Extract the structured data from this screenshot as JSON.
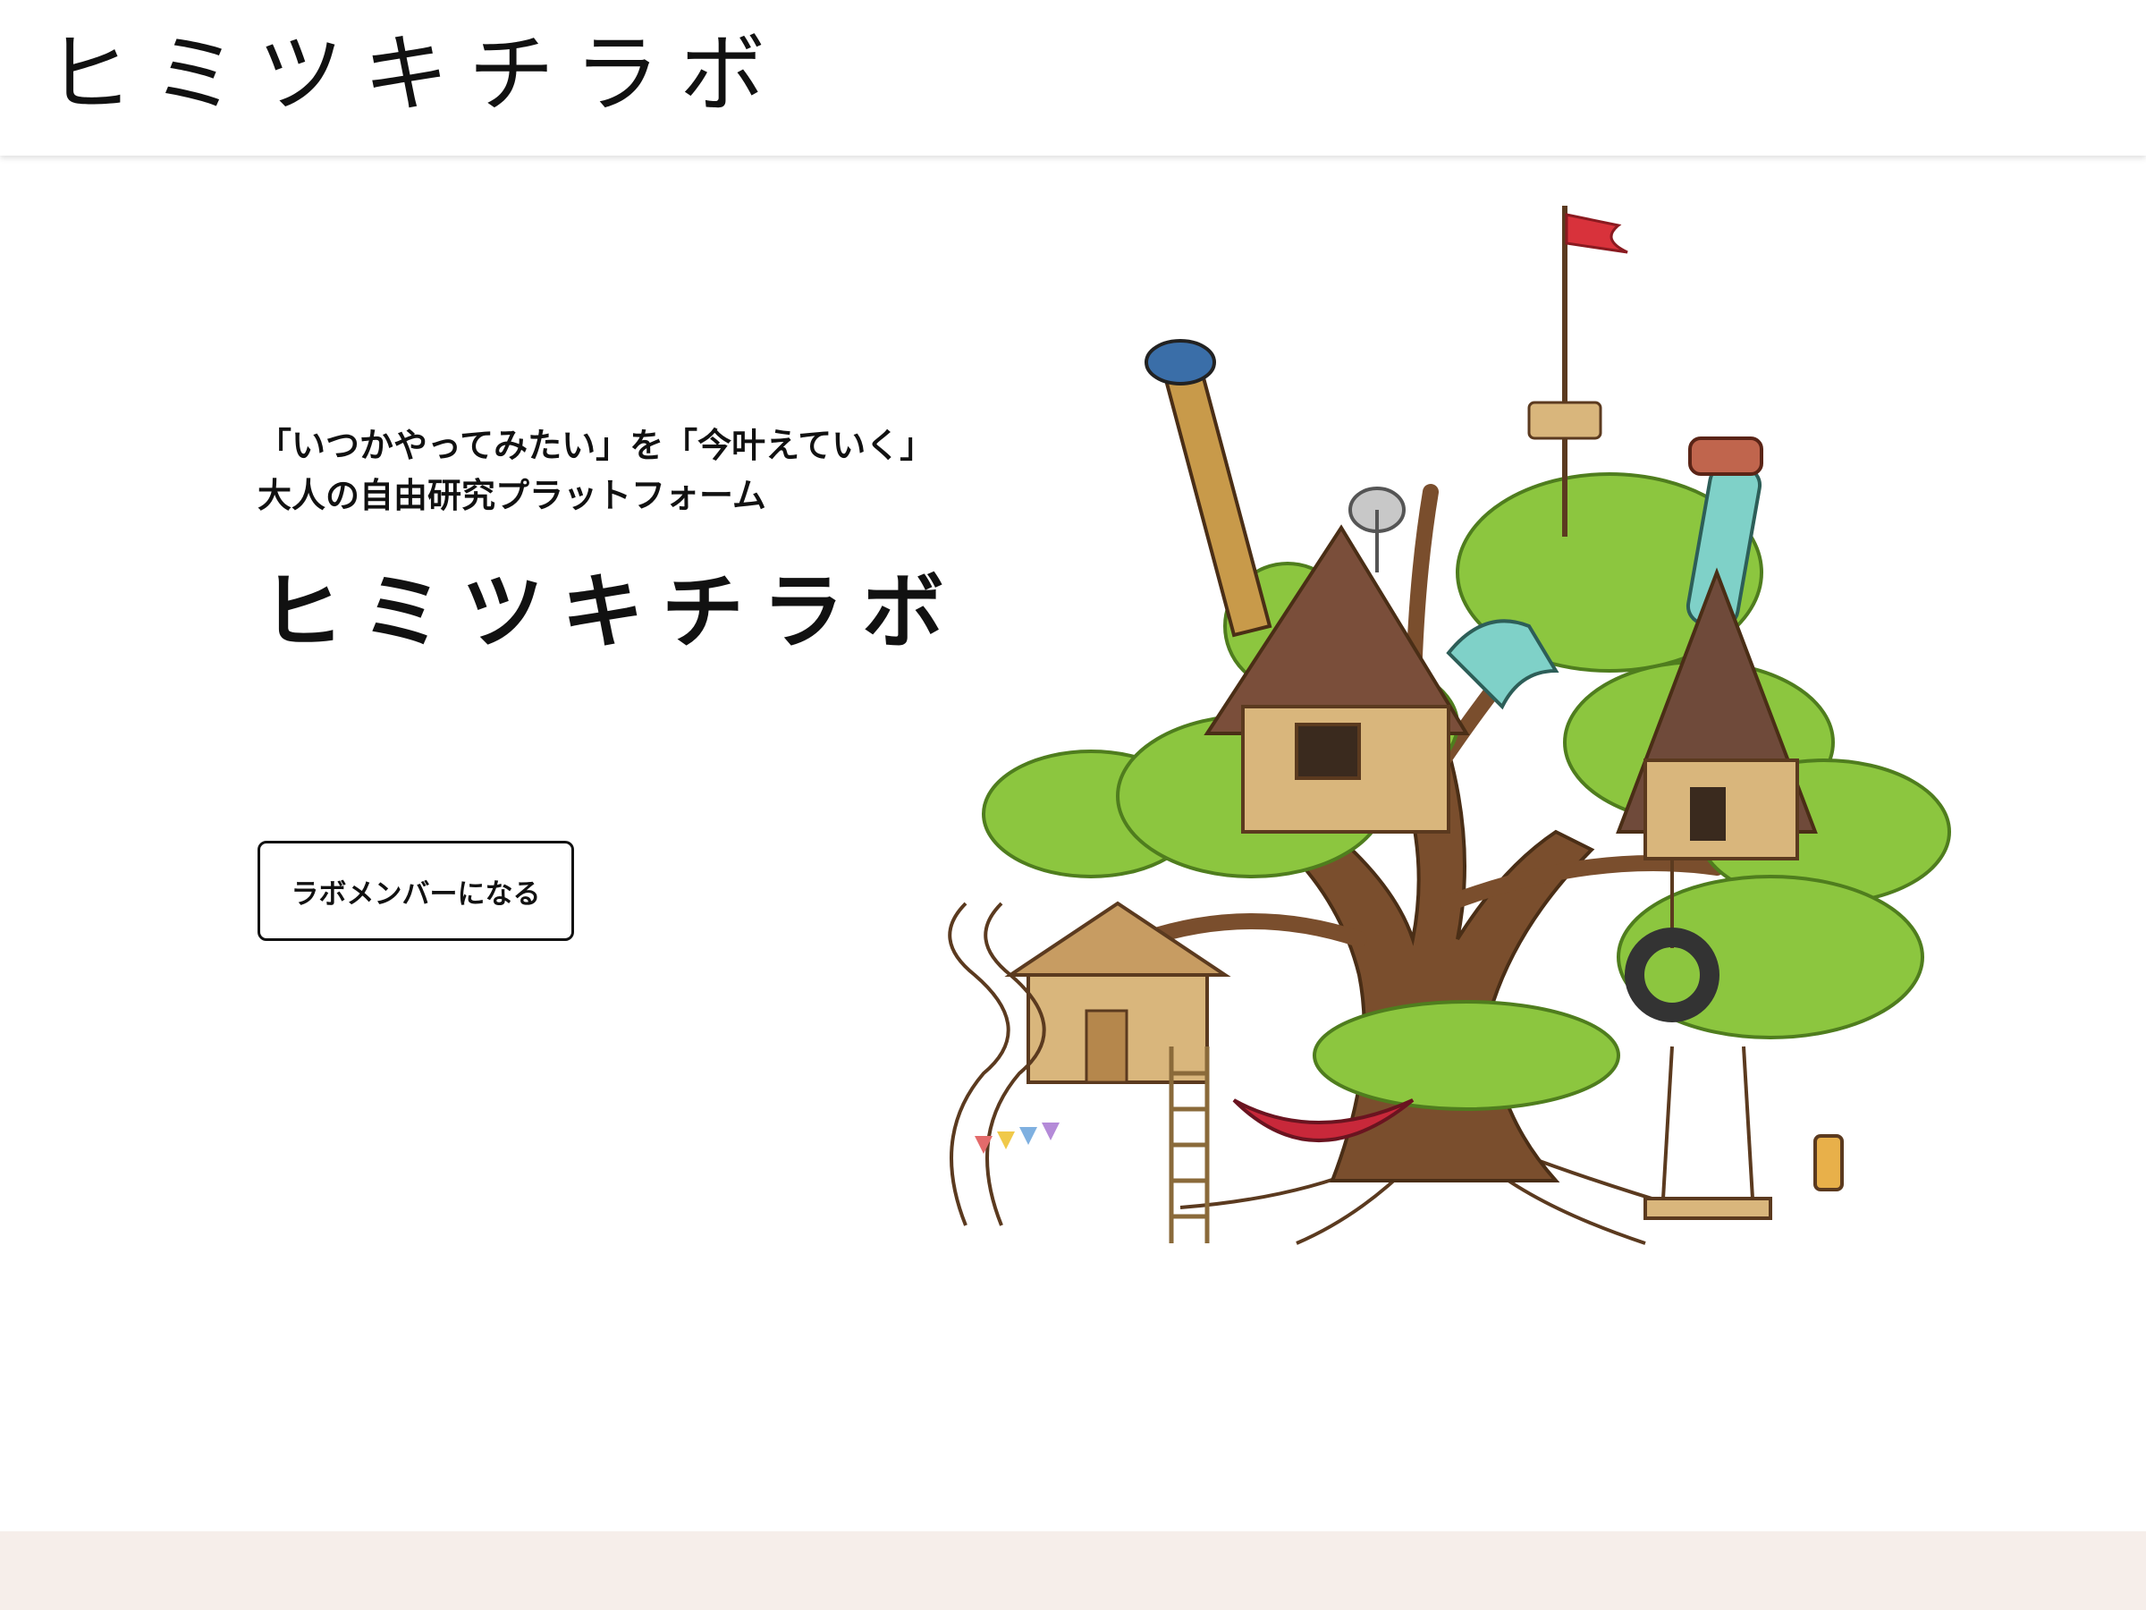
{
  "header": {
    "logo_text": "ヒミツキチラボ"
  },
  "hero": {
    "tagline_line1": "「いつかやってみたい」を「今叶えていく」",
    "tagline_line2": "大人の自由研究プラットフォーム",
    "logo_text": "ヒミツキチラボ",
    "cta_label": "ラボメンバーになる"
  },
  "colors": {
    "text": "#111111",
    "background": "#ffffff",
    "footer_band": "#f6eeea",
    "leaf": "#8cc63f",
    "trunk": "#7a4e2d",
    "wood": "#d9b67c",
    "pipe": "#7fd1c8",
    "flag": "#d8323b"
  }
}
